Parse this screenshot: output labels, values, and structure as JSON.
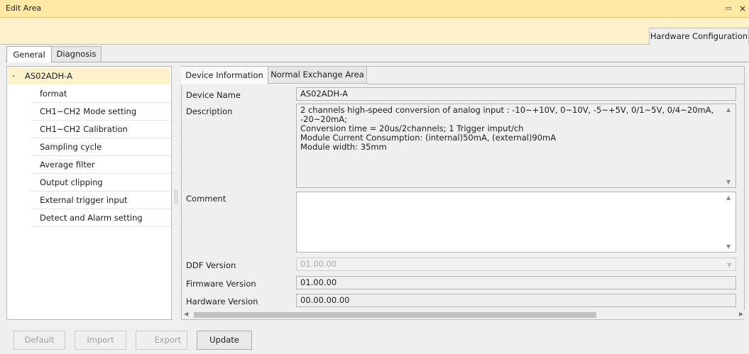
{
  "window": {
    "title": "Edit Area",
    "restore_symbol": "▭",
    "close_symbol": "×"
  },
  "top_tab": {
    "label": "Hardware Configuration"
  },
  "sub_tabs": [
    {
      "label": "General",
      "active": true
    },
    {
      "label": "Diagnosis",
      "active": false
    }
  ],
  "tree": {
    "root": {
      "toggle": "-",
      "label": "AS02ADH-A"
    },
    "items": [
      "format",
      "CH1~CH2 Mode setting",
      "CH1~CH2 Calibration",
      "Sampling cycle",
      "Average filter",
      "Output clipping",
      "External trigger input",
      "Detect and Alarm setting"
    ]
  },
  "panel_tabs": [
    {
      "label": "Device Information",
      "active": true
    },
    {
      "label": "Normal Exchange Area",
      "active": false
    }
  ],
  "device_info": {
    "device_name_label": "Device Name",
    "device_name": "AS02ADH-A",
    "description_label": "Description",
    "description": "2 channels high-speed conversion of analog input : -10~+10V, 0~10V, -5~+5V, 0/1~5V, 0/4~20mA, -20~20mA;\nConversion time = 20us/2channels;  1 Trigger imput/ch\nModule Current Consumption: (internal)50mA, (external)90mA\nModule width: 35mm",
    "comment_label": "Comment",
    "comment": "",
    "ddf_version_label": "DDF Version",
    "ddf_version": "01.00.00",
    "firmware_version_label": "Firmware Version",
    "firmware_version": "01.00.00",
    "hardware_version_label": "Hardware Version",
    "hardware_version": "00.00.00.00"
  },
  "buttons": {
    "default": "Default",
    "import": "Import",
    "export": "Export",
    "update": "Update"
  },
  "colors": {
    "titlebar": "#fde9a3",
    "selection": "#fdf2cc",
    "background": "#f0f0f0"
  }
}
